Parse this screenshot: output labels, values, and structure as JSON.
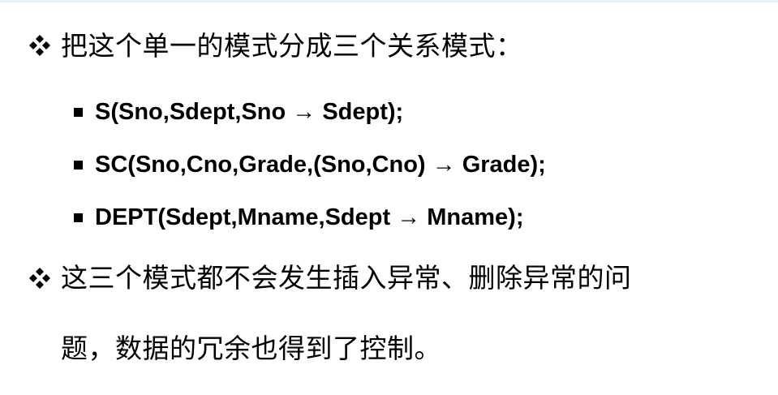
{
  "slide": {
    "bullets": [
      {
        "icon": "four-diamond-bullet-icon",
        "text": "把这个单一的模式分成三个关系模式："
      },
      {
        "icon": "four-diamond-bullet-icon",
        "lines": [
          "这三个模式都不会发生插入异常、删除异常的问",
          "题，数据的冗余也得到了控制。"
        ]
      }
    ],
    "sub_items": [
      {
        "icon": "square-bullet-icon",
        "text": "S(Sno,Sdept,Sno → Sdept);"
      },
      {
        "icon": "square-bullet-icon",
        "text": "SC(Sno,Cno,Grade,(Sno,Cno) → Grade);"
      },
      {
        "icon": "square-bullet-icon",
        "text": "DEPT(Sdept,Mname,Sdept → Mname);"
      }
    ]
  }
}
